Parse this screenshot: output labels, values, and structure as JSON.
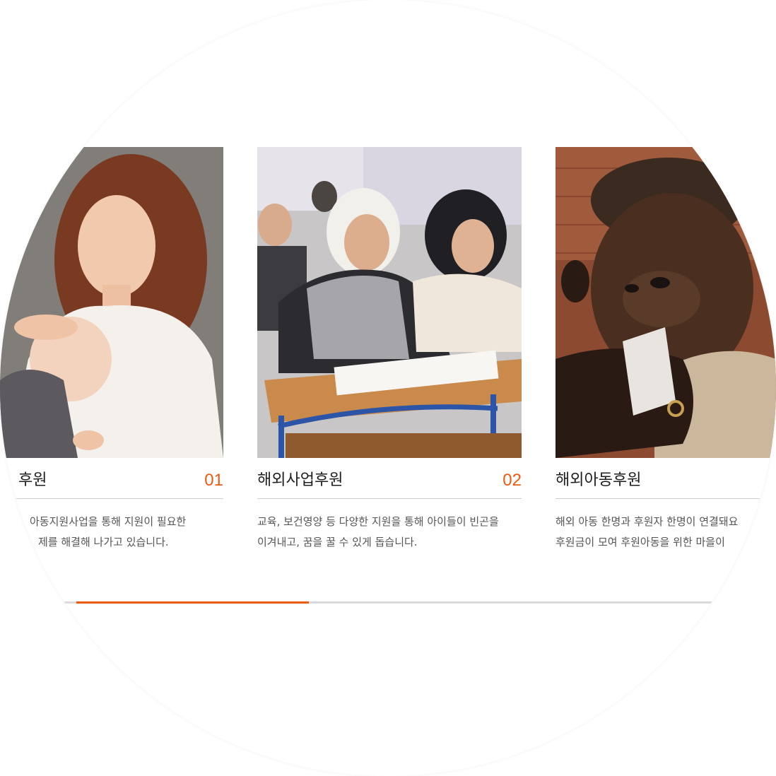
{
  "cards": [
    {
      "title": "해외아동후원",
      "title_visible": "후원",
      "number": "01",
      "desc_line1": "해외아동지원사업을 통해 지원이 필요한",
      "desc_line1_visible": "아동지원사업을 통해 지원이 필요한",
      "desc_line2_visible": "제를 해결해 나가고 있습니다.",
      "image_icon": "mother-holding-baby-photo"
    },
    {
      "title": "해외사업후원",
      "number": "02",
      "desc_line1": "교육, 보건영양 등 다양한 지원을 통해 아이들이 빈곤을",
      "desc_line2": "이겨내고, 꿈을 꿀 수 있게 돕습니다.",
      "image_icon": "children-in-classroom-photo"
    },
    {
      "title": "해외아동후원",
      "desc_line1": "해외 아동 한명과 후원자 한명이 연결돼요",
      "desc_line2": "후원금이 모여 후원아동을 위한 마을이",
      "image_icon": "child-eating-photo"
    }
  ],
  "progress": {
    "value": 0.36
  },
  "colors": {
    "accent": "#ec5a12",
    "track": "#dadada",
    "divider": "#cfcfcf"
  }
}
